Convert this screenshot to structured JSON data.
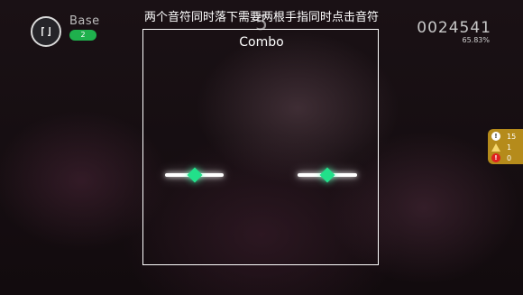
{
  "hud": {
    "level_name": "Base",
    "level_number": "2",
    "hint": "两个音符同时落下需要两根手指同时点击音符",
    "combo_count": "5",
    "combo_label": "Combo",
    "score": "0024541",
    "accuracy": "65.83%"
  },
  "icons": {
    "pause": "pause-icon",
    "judge_perfect": "exclamation-circle-icon",
    "judge_good": "warning-triangle-icon",
    "judge_miss": "error-circle-icon"
  },
  "judgements": [
    {
      "name": "perfect",
      "count": "15"
    },
    {
      "name": "good",
      "count": "1"
    },
    {
      "name": "miss",
      "count": "0"
    }
  ],
  "colors": {
    "level_badge": "#1fb14d",
    "note_gem": "#22e08a",
    "judge_panel": "#b58b1b",
    "miss_icon": "#e02020",
    "good_icon": "#f5d76e"
  }
}
